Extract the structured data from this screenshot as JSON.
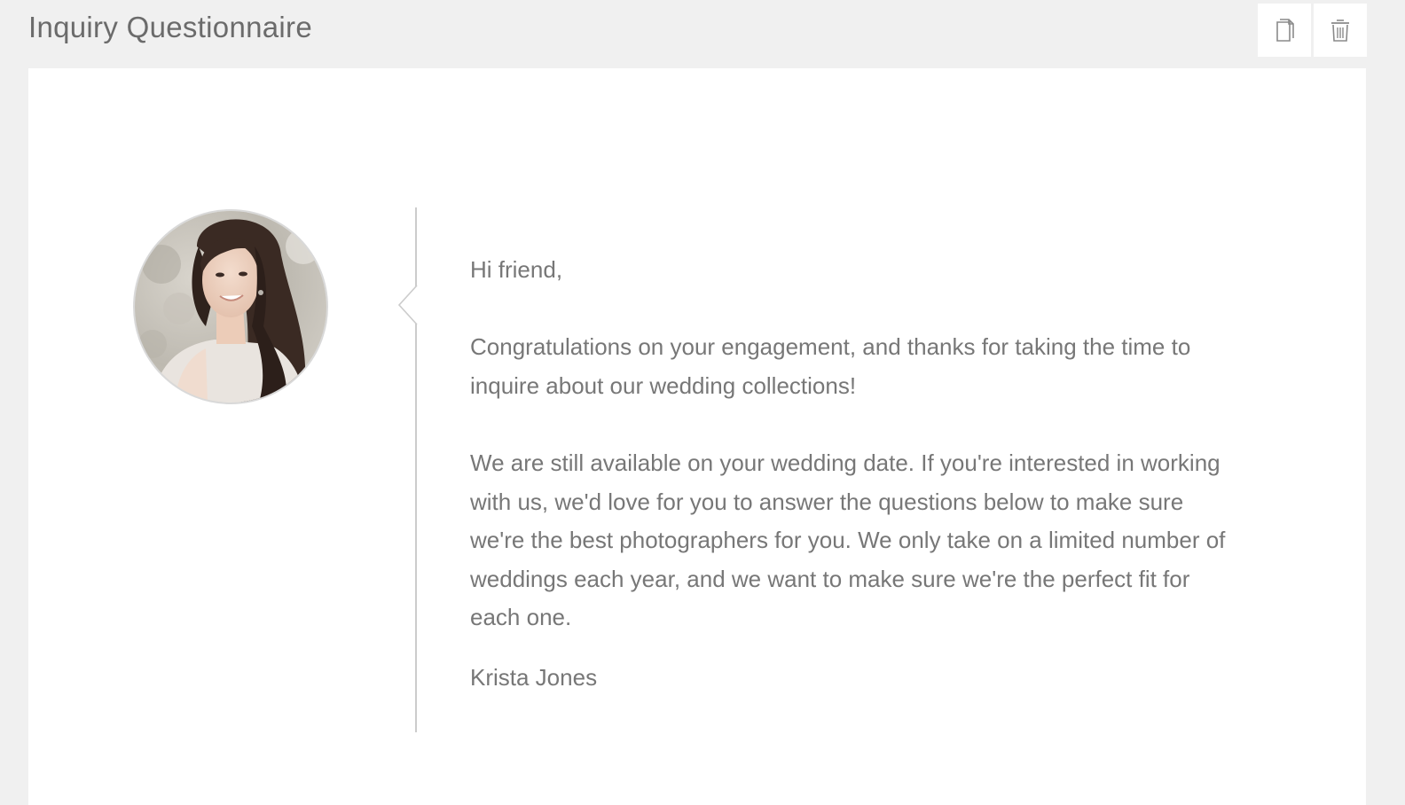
{
  "header": {
    "title": "Inquiry Questionnaire",
    "actions": [
      {
        "name": "copy",
        "icon": "copy-icon"
      },
      {
        "name": "delete",
        "icon": "trash-icon"
      }
    ]
  },
  "message": {
    "greeting": "Hi friend,",
    "paragraph1": "Congratulations on your engagement, and thanks for taking the time to inquire about our wedding collections!",
    "paragraph2": "We are still available on your wedding date. If you're interested in working with us, we'd love for you to answer the questions below to make sure we're the best photographers for you. We only take on a limited number of weddings each year, and we want to make sure we're the perfect fit for each one.",
    "signature": "Krista Jones"
  },
  "colors": {
    "page_background": "#f0f0f0",
    "card_background": "#ffffff",
    "text": "#777777",
    "divider": "#cccccc"
  }
}
